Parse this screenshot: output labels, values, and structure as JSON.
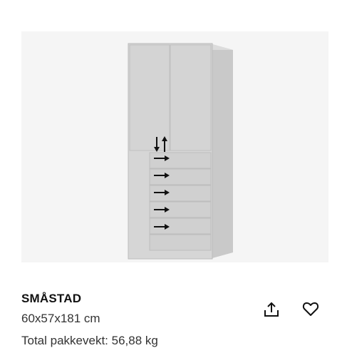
{
  "product": {
    "name": "SMÅSTAD",
    "dimensions": "60x57x181 cm",
    "weight": "Total pakkevekt: 56,88 kg"
  },
  "image": {
    "background": "#f5f5f5",
    "cabinet_color": "#d2d2d2",
    "arrow_color": "#111111"
  },
  "actions": {
    "share_icon": "share-icon",
    "favourite_icon": "heart-outline-icon"
  }
}
